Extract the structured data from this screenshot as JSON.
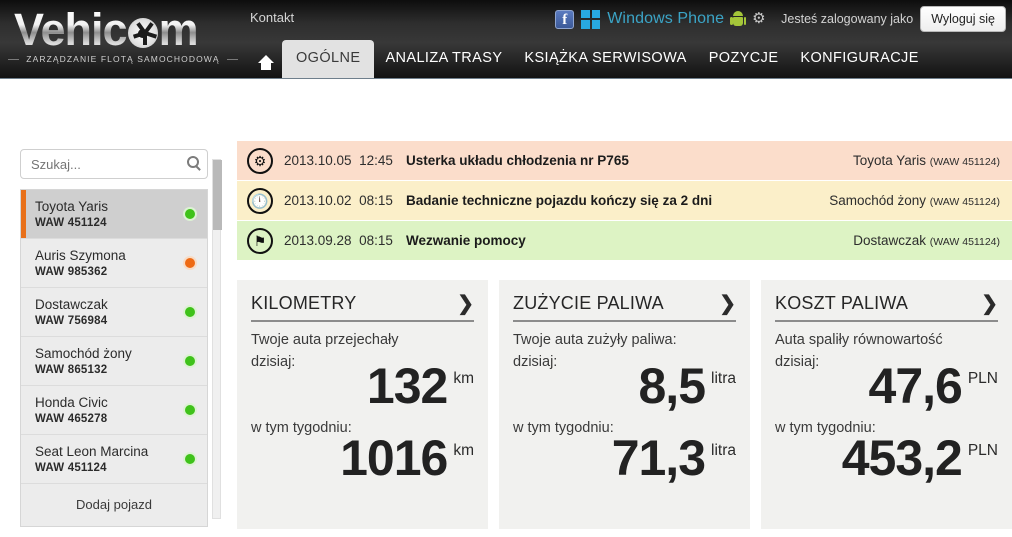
{
  "header": {
    "logo_text": "Vehic",
    "logo_text_end": "m",
    "tagline": "ZARZĄDZANIE FLOTĄ SAMOCHODOWĄ",
    "kontakt": "Kontakt",
    "windows_phone": "Windows Phone",
    "logged_label": "Jesteś zalogowany jako",
    "logout": "Wyloguj się"
  },
  "nav": {
    "home_icon": "home-icon",
    "items": [
      {
        "label": "OGÓLNE",
        "active": true
      },
      {
        "label": "ANALIZA TRASY",
        "active": false
      },
      {
        "label": "KSIĄŻKA SERWISOWA",
        "active": false
      },
      {
        "label": "POZYCJE",
        "active": false
      },
      {
        "label": "KONFIGURACJE",
        "active": false
      }
    ]
  },
  "sidebar": {
    "search_placeholder": "Szukaj...",
    "search_value": "",
    "add_vehicle": "Dodaj pojazd",
    "vehicles": [
      {
        "name": "Toyota Yaris",
        "plate": "WAW 451124",
        "status": "green",
        "selected": true
      },
      {
        "name": "Auris Szymona",
        "plate": "WAW 985362",
        "status": "orange",
        "selected": false
      },
      {
        "name": "Dostawczak",
        "plate": "WAW 756984",
        "status": "green",
        "selected": false
      },
      {
        "name": "Samochód żony",
        "plate": "WAW 865132",
        "status": "green",
        "selected": false
      },
      {
        "name": "Honda Civic",
        "plate": "WAW 465278",
        "status": "green",
        "selected": false
      },
      {
        "name": "Seat Leon Marcina",
        "plate": "WAW 451124",
        "status": "green",
        "selected": false
      }
    ]
  },
  "alerts": [
    {
      "icon": "gear-icon",
      "color": "red",
      "date": "2013.10.05",
      "time": "12:45",
      "message": "Usterka układu chłodzenia nr P765",
      "vehicle": "Toyota Yaris",
      "plate": "(WAW 451124)"
    },
    {
      "icon": "clock-icon",
      "color": "yellow",
      "date": "2013.10.02",
      "time": "08:15",
      "message": "Badanie techniczne pojazdu kończy się za 2 dni",
      "vehicle": "Samochód żony",
      "plate": "(WAW 451124)"
    },
    {
      "icon": "flag-icon",
      "color": "green",
      "date": "2013.09.28",
      "time": "08:15",
      "message": "Wezwanie pomocy",
      "vehicle": "Dostawczak",
      "plate": "(WAW 451124)"
    }
  ],
  "cards": [
    {
      "title": "KILOMETRY",
      "subtitle": "Twoje auta przejechały",
      "today_label": "dzisiaj:",
      "today_value": "132",
      "today_unit": "km",
      "week_label": "w tym tygodniu:",
      "week_value": "1016",
      "week_unit": "km"
    },
    {
      "title": "ZUŻYCIE PALIWA",
      "subtitle": "Twoje auta zużyły paliwa:",
      "today_label": "dzisiaj:",
      "today_value": "8,5",
      "today_unit": "litra",
      "week_label": "w tym tygodniu:",
      "week_value": "71,3",
      "week_unit": "litra"
    },
    {
      "title": "KOSZT PALIWA",
      "subtitle": "Auta spaliły równowartość",
      "today_label": "dzisiaj:",
      "today_value": "47,6",
      "today_unit": "PLN",
      "week_label": "w tym tygodniu:",
      "week_value": "453,2",
      "week_unit": "PLN"
    }
  ],
  "colors": {
    "accent_orange": "#e8701a",
    "status_green": "#3fc21a",
    "status_orange": "#ee6a14",
    "alert_red_bg": "#fbddcb",
    "alert_yellow_bg": "#fbefc9",
    "alert_green_bg": "#ddf3c4",
    "wp_blue": "#3ba4c6"
  }
}
